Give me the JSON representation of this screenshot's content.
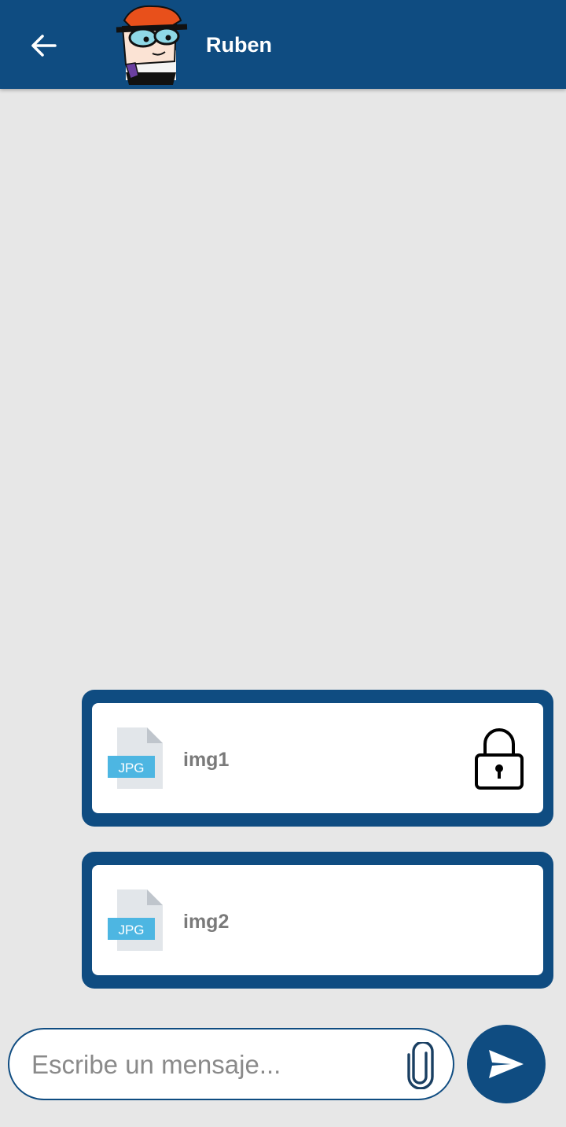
{
  "header": {
    "contact_name": "Ruben",
    "back_icon": "arrow-left-icon",
    "avatar_icon": "cartoon-avatar-icon"
  },
  "messages": [
    {
      "file_type": "JPG",
      "file_name": "img1",
      "locked": true,
      "file_icon": "jpg-file-icon",
      "lock_icon": "lock-icon"
    },
    {
      "file_type": "JPG",
      "file_name": "img2",
      "locked": false,
      "file_icon": "jpg-file-icon"
    }
  ],
  "composer": {
    "placeholder": "Escribe un mensaje...",
    "value": "",
    "attach_icon": "paperclip-icon",
    "send_icon": "send-icon"
  },
  "colors": {
    "primary": "#0f4c81",
    "background": "#e7e7e7",
    "bubble_inner": "#ffffff",
    "file_badge": "#4db6e2",
    "file_name_text": "#7a7a7a"
  }
}
